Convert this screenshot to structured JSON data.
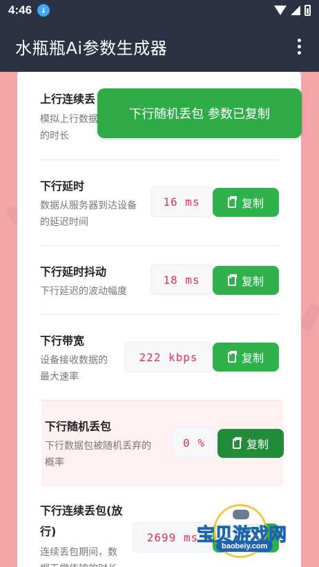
{
  "status": {
    "time": "4:46"
  },
  "app": {
    "title": "水瓶瓶Ai参数生成器"
  },
  "toast": {
    "text": "下行随机丢包 参数已复制"
  },
  "rows": [
    {
      "title": "上行连续丢",
      "desc": "模拟上行数据",
      "desc2": "的时长"
    },
    {
      "title": "下行延时",
      "desc": "数据从服务器到达设备",
      "desc2": "的延迟时间",
      "value": "16 ms",
      "button": "复制"
    },
    {
      "title": "下行延时抖动",
      "desc": "下行延迟的波动幅度",
      "value": "18 ms",
      "button": "复制"
    },
    {
      "title": "下行带宽",
      "desc": "设备接收数据的",
      "desc2": "最大速率",
      "value": "222 kbps",
      "button": "复制"
    },
    {
      "title": "下行随机丢包",
      "desc": "下行数据包被随机丢弃的",
      "desc2": "概率",
      "value": "0 %",
      "button": "复制"
    },
    {
      "title": "下行连续丢包(放",
      "title2": "行)",
      "desc": "连续丢包期间，数",
      "desc2": "据无常传输的时长",
      "value": "2699 ms",
      "button": "复制"
    }
  ],
  "watermark": {
    "text": "宝贝游戏网",
    "url": "baobeiy.com"
  },
  "colors": {
    "toast": "#2fac48",
    "button": "#2fb24c",
    "value_text": "#e0315a",
    "app_bar": "#2b3342"
  }
}
